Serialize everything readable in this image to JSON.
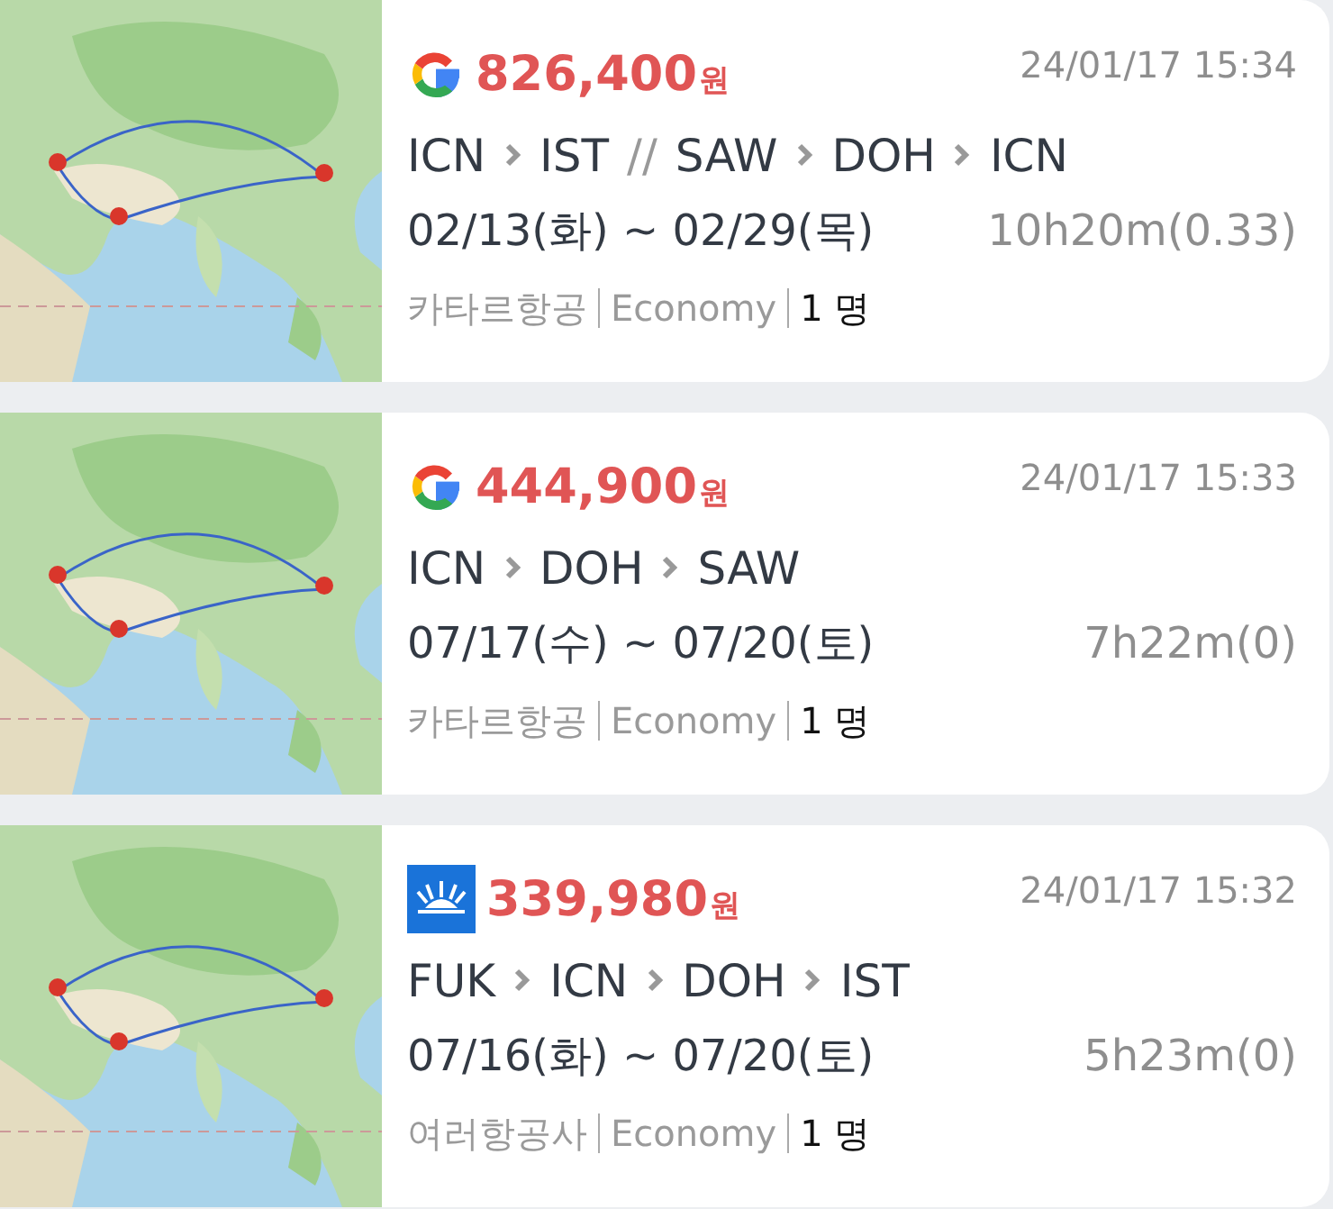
{
  "results": [
    {
      "source": {
        "kind": "google"
      },
      "price": "826,400",
      "currency": "원",
      "timestamp": "24/01/17 15:34",
      "route": [
        {
          "kind": "airport",
          "text": "ICN"
        },
        {
          "kind": "arrow"
        },
        {
          "kind": "airport",
          "text": "IST"
        },
        {
          "kind": "break",
          "text": "//"
        },
        {
          "kind": "airport",
          "text": "SAW"
        },
        {
          "kind": "arrow"
        },
        {
          "kind": "airport",
          "text": "DOH"
        },
        {
          "kind": "arrow"
        },
        {
          "kind": "airport",
          "text": "ICN"
        }
      ],
      "dates": "02/13(화) ~ 02/29(목)",
      "duration": "10h20m(0.33)",
      "airline": "카타르항공",
      "cabin": "Economy",
      "passengers": "1 명"
    },
    {
      "source": {
        "kind": "google"
      },
      "price": "444,900",
      "currency": "원",
      "timestamp": "24/01/17 15:33",
      "route": [
        {
          "kind": "airport",
          "text": "ICN"
        },
        {
          "kind": "arrow"
        },
        {
          "kind": "airport",
          "text": "DOH"
        },
        {
          "kind": "arrow"
        },
        {
          "kind": "airport",
          "text": "SAW"
        }
      ],
      "dates": "07/17(수) ~ 07/20(토)",
      "duration": "7h22m(0)",
      "airline": "카타르항공",
      "cabin": "Economy",
      "passengers": "1 명"
    },
    {
      "source": {
        "kind": "sun"
      },
      "price": "339,980",
      "currency": "원",
      "timestamp": "24/01/17 15:32",
      "route": [
        {
          "kind": "airport",
          "text": "FUK"
        },
        {
          "kind": "arrow"
        },
        {
          "kind": "airport",
          "text": "ICN"
        },
        {
          "kind": "arrow"
        },
        {
          "kind": "airport",
          "text": "DOH"
        },
        {
          "kind": "arrow"
        },
        {
          "kind": "airport",
          "text": "IST"
        }
      ],
      "dates": "07/16(화) ~ 07/20(토)",
      "duration": "5h23m(0)",
      "airline": "여러항공사",
      "cabin": "Economy",
      "passengers": "1 명"
    }
  ]
}
